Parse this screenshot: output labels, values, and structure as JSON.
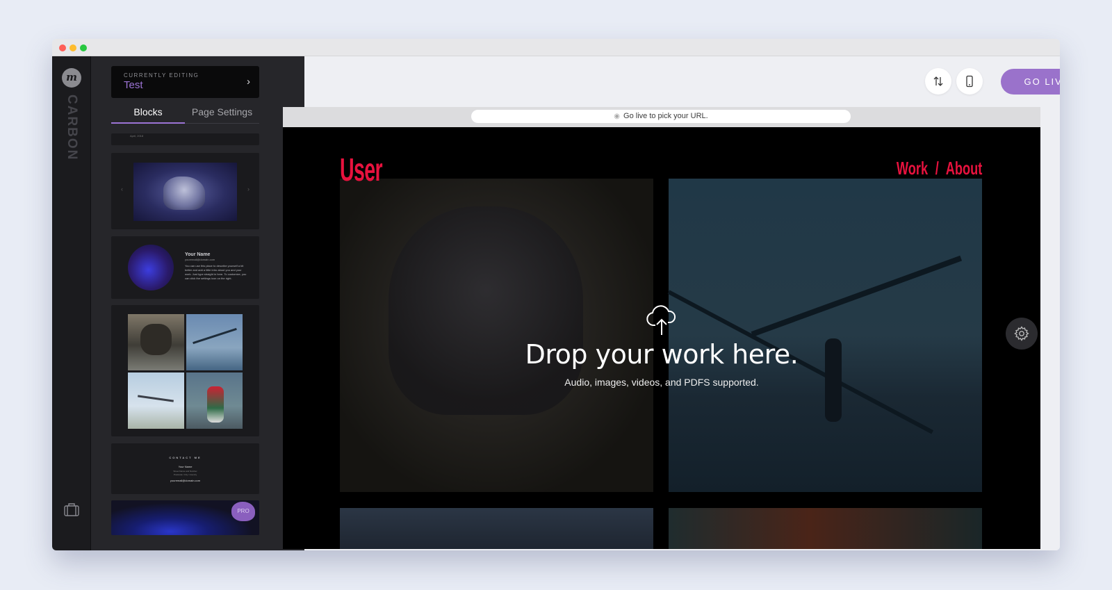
{
  "sidebar": {
    "logo_text": "m",
    "brand": "CARBON",
    "briefcase_icon": "briefcase-icon"
  },
  "panel": {
    "currently_editing_label": "CURRENTLY EDITING",
    "editing_name": "Test",
    "tabs": [
      {
        "label": "Blocks",
        "active": true
      },
      {
        "label": "Page Settings",
        "active": false
      }
    ],
    "block_previews": {
      "date_text": "April, 2018",
      "bio_name": "Your Name",
      "bio_email": "youremail@domain.com",
      "bio_text": "You can use this place to describe yourself a bit better and add a little intro about you and your work. Just type straight in here. To customize, you can click the settings icon on the right.",
      "contact_heading": "CONTACT ME",
      "contact_name": "Your Name",
      "contact_line1": "Street Name and Number",
      "contact_line2": "Postcode / City / Country",
      "contact_email": "youremail@domain.com",
      "pro_badge": "PRO"
    }
  },
  "toolbar": {
    "go_live_label": "GO LIVE",
    "reorder_icon": "reorder-icon",
    "mobile_icon": "mobile-icon"
  },
  "preview": {
    "url_message": "Go live to pick your URL.",
    "site_title": "User",
    "nav": [
      "Work",
      "About"
    ],
    "nav_separator": "/",
    "drop_title": "Drop your work here.",
    "drop_subtitle": "Audio, images, videos, and PDFS supported."
  },
  "colors": {
    "accent": "#9a72cb",
    "site_red": "#e8123e",
    "rail": "#1b1b1e",
    "panel": "#26262a"
  }
}
